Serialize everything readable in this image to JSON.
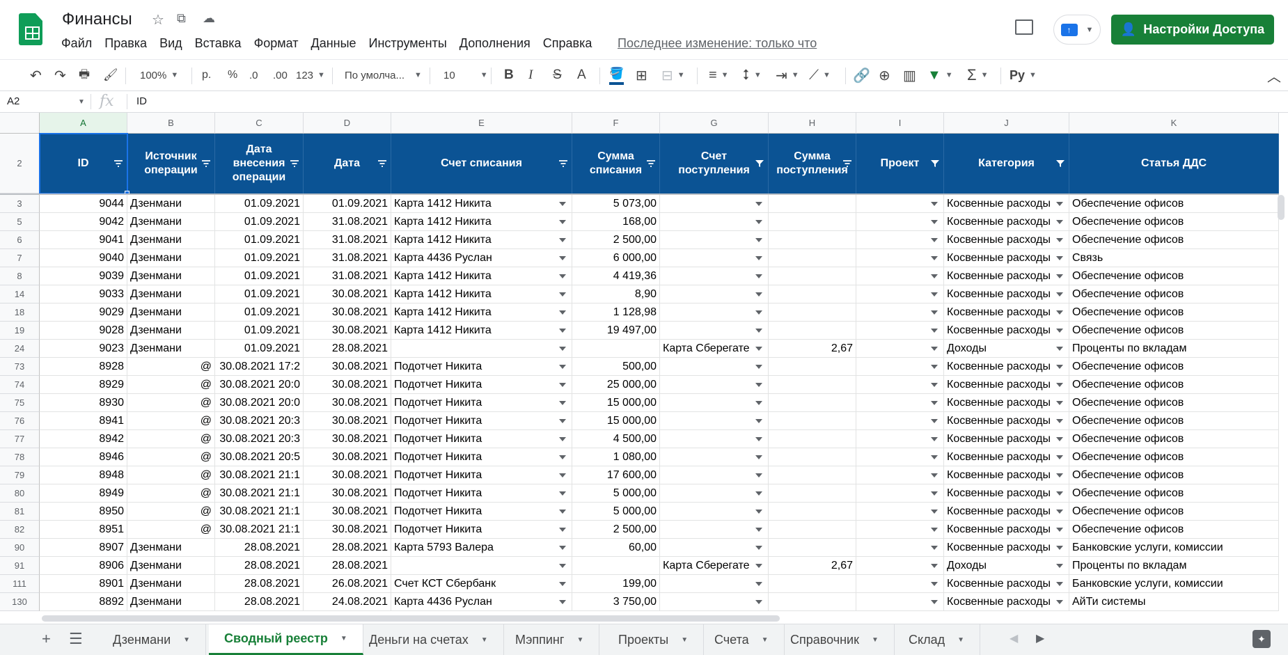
{
  "doc": {
    "title": "Финансы",
    "last_edit": "Последнее изменение: только что"
  },
  "menu": [
    "Файл",
    "Правка",
    "Вид",
    "Вставка",
    "Формат",
    "Данные",
    "Инструменты",
    "Дополнения",
    "Справка"
  ],
  "share_label": "Настройки Доступа",
  "toolbar": {
    "zoom": "100%",
    "currency": "р.",
    "percent": "%",
    "dec_less": ".0",
    "dec_more": ".00",
    "format": "123",
    "font": "По умолча...",
    "size": "10",
    "bold": "B",
    "italic": "I",
    "strike": "S",
    "textcolor": "A",
    "script": "Py"
  },
  "formula": {
    "ref": "A2",
    "fx": "fx",
    "value": "ID"
  },
  "columns": [
    "A",
    "B",
    "C",
    "D",
    "E",
    "F",
    "G",
    "H",
    "I",
    "J",
    "K"
  ],
  "header_row_num": "2",
  "headers": [
    "ID",
    "Источник операции",
    "Дата внесения операции",
    "Дата",
    "Счет списания",
    "Сумма списания",
    "Счет поступления",
    "Сумма поступления",
    "Проект",
    "Категория",
    "Статья ДДС"
  ],
  "rows": [
    {
      "n": "3",
      "id": "9044",
      "src": "Дзенмани",
      "dv": "01.09.2021",
      "d": "01.09.2021",
      "acc": "Карта 1412 Никита",
      "sum": "5 073,00",
      "inacc": "",
      "insum": "",
      "cat": "Косвенные расходы",
      "art": "Обеспечение офисов"
    },
    {
      "n": "5",
      "id": "9042",
      "src": "Дзенмани",
      "dv": "01.09.2021",
      "d": "31.08.2021",
      "acc": "Карта 1412 Никита",
      "sum": "168,00",
      "inacc": "",
      "insum": "",
      "cat": "Косвенные расходы",
      "art": "Обеспечение офисов"
    },
    {
      "n": "6",
      "id": "9041",
      "src": "Дзенмани",
      "dv": "01.09.2021",
      "d": "31.08.2021",
      "acc": "Карта 1412 Никита",
      "sum": "2 500,00",
      "inacc": "",
      "insum": "",
      "cat": "Косвенные расходы",
      "art": "Обеспечение офисов"
    },
    {
      "n": "7",
      "id": "9040",
      "src": "Дзенмани",
      "dv": "01.09.2021",
      "d": "31.08.2021",
      "acc": "Карта 4436 Руслан",
      "sum": "6 000,00",
      "inacc": "",
      "insum": "",
      "cat": "Косвенные расходы",
      "art": "Связь"
    },
    {
      "n": "8",
      "id": "9039",
      "src": "Дзенмани",
      "dv": "01.09.2021",
      "d": "31.08.2021",
      "acc": "Карта 1412 Никита",
      "sum": "4 419,36",
      "inacc": "",
      "insum": "",
      "cat": "Косвенные расходы",
      "art": "Обеспечение офисов"
    },
    {
      "n": "14",
      "id": "9033",
      "src": "Дзенмани",
      "dv": "01.09.2021",
      "d": "30.08.2021",
      "acc": "Карта 1412 Никита",
      "sum": "8,90",
      "inacc": "",
      "insum": "",
      "cat": "Косвенные расходы",
      "art": "Обеспечение офисов"
    },
    {
      "n": "18",
      "id": "9029",
      "src": "Дзенмани",
      "dv": "01.09.2021",
      "d": "30.08.2021",
      "acc": "Карта 1412 Никита",
      "sum": "1 128,98",
      "inacc": "",
      "insum": "",
      "cat": "Косвенные расходы",
      "art": "Обеспечение офисов"
    },
    {
      "n": "19",
      "id": "9028",
      "src": "Дзенмани",
      "dv": "01.09.2021",
      "d": "30.08.2021",
      "acc": "Карта 1412 Никита",
      "sum": "19 497,00",
      "inacc": "",
      "insum": "",
      "cat": "Косвенные расходы",
      "art": "Обеспечение офисов"
    },
    {
      "n": "24",
      "id": "9023",
      "src": "Дзенмани",
      "dv": "01.09.2021",
      "d": "28.08.2021",
      "acc": "",
      "sum": "",
      "inacc": "Карта Сберегате",
      "insum": "2,67",
      "cat": "Доходы",
      "art": "Проценты по вкладам"
    },
    {
      "n": "73",
      "id": "8928",
      "src": "@",
      "dv": "30.08.2021 17:2",
      "d": "30.08.2021",
      "acc": "Подотчет Никита",
      "sum": "500,00",
      "inacc": "",
      "insum": "",
      "cat": "Косвенные расходы",
      "art": "Обеспечение офисов"
    },
    {
      "n": "74",
      "id": "8929",
      "src": "@",
      "dv": "30.08.2021 20:0",
      "d": "30.08.2021",
      "acc": "Подотчет Никита",
      "sum": "25 000,00",
      "inacc": "",
      "insum": "",
      "cat": "Косвенные расходы",
      "art": "Обеспечение офисов"
    },
    {
      "n": "75",
      "id": "8930",
      "src": "@",
      "dv": "30.08.2021 20:0",
      "d": "30.08.2021",
      "acc": "Подотчет Никита",
      "sum": "15 000,00",
      "inacc": "",
      "insum": "",
      "cat": "Косвенные расходы",
      "art": "Обеспечение офисов"
    },
    {
      "n": "76",
      "id": "8941",
      "src": "@",
      "dv": "30.08.2021 20:3",
      "d": "30.08.2021",
      "acc": "Подотчет Никита",
      "sum": "15 000,00",
      "inacc": "",
      "insum": "",
      "cat": "Косвенные расходы",
      "art": "Обеспечение офисов"
    },
    {
      "n": "77",
      "id": "8942",
      "src": "@",
      "dv": "30.08.2021 20:3",
      "d": "30.08.2021",
      "acc": "Подотчет Никита",
      "sum": "4 500,00",
      "inacc": "",
      "insum": "",
      "cat": "Косвенные расходы",
      "art": "Обеспечение офисов"
    },
    {
      "n": "78",
      "id": "8946",
      "src": "@",
      "dv": "30.08.2021 20:5",
      "d": "30.08.2021",
      "acc": "Подотчет Никита",
      "sum": "1 080,00",
      "inacc": "",
      "insum": "",
      "cat": "Косвенные расходы",
      "art": "Обеспечение офисов"
    },
    {
      "n": "79",
      "id": "8948",
      "src": "@",
      "dv": "30.08.2021 21:1",
      "d": "30.08.2021",
      "acc": "Подотчет Никита",
      "sum": "17 600,00",
      "inacc": "",
      "insum": "",
      "cat": "Косвенные расходы",
      "art": "Обеспечение офисов"
    },
    {
      "n": "80",
      "id": "8949",
      "src": "@",
      "dv": "30.08.2021 21:1",
      "d": "30.08.2021",
      "acc": "Подотчет Никита",
      "sum": "5 000,00",
      "inacc": "",
      "insum": "",
      "cat": "Косвенные расходы",
      "art": "Обеспечение офисов"
    },
    {
      "n": "81",
      "id": "8950",
      "src": "@",
      "dv": "30.08.2021 21:1",
      "d": "30.08.2021",
      "acc": "Подотчет Никита",
      "sum": "5 000,00",
      "inacc": "",
      "insum": "",
      "cat": "Косвенные расходы",
      "art": "Обеспечение офисов"
    },
    {
      "n": "82",
      "id": "8951",
      "src": "@",
      "dv": "30.08.2021 21:1",
      "d": "30.08.2021",
      "acc": "Подотчет Никита",
      "sum": "2 500,00",
      "inacc": "",
      "insum": "",
      "cat": "Косвенные расходы",
      "art": "Обеспечение офисов"
    },
    {
      "n": "90",
      "id": "8907",
      "src": "Дзенмани",
      "dv": "28.08.2021",
      "d": "28.08.2021",
      "acc": "Карта 5793 Валера",
      "sum": "60,00",
      "inacc": "",
      "insum": "",
      "cat": "Косвенные расходы",
      "art": "Банковские услуги, комиссии"
    },
    {
      "n": "91",
      "id": "8906",
      "src": "Дзенмани",
      "dv": "28.08.2021",
      "d": "28.08.2021",
      "acc": "",
      "sum": "",
      "inacc": "Карта Сберегате",
      "insum": "2,67",
      "cat": "Доходы",
      "art": "Проценты по вкладам"
    },
    {
      "n": "111",
      "id": "8901",
      "src": "Дзенмани",
      "dv": "28.08.2021",
      "d": "26.08.2021",
      "acc": "Счет КСТ Сбербанк",
      "sum": "199,00",
      "inacc": "",
      "insum": "",
      "cat": "Косвенные расходы",
      "art": "Банковские услуги, комиссии"
    },
    {
      "n": "130",
      "id": "8892",
      "src": "Дзенмани",
      "dv": "28.08.2021",
      "d": "24.08.2021",
      "acc": "Карта 4436 Руслан",
      "sum": "3 750,00",
      "inacc": "",
      "insum": "",
      "cat": "Косвенные расходы",
      "art": "АйТи системы"
    }
  ],
  "tabs": [
    "Дзенмани",
    "Сводный реестр",
    "Деньги на счетах",
    "Мэппинг",
    "Проекты",
    "Счета",
    "Справочник",
    "Склад"
  ],
  "active_tab": "Сводный реестр",
  "colors": {
    "accent": "#188038",
    "header_bg": "#0b5394"
  }
}
